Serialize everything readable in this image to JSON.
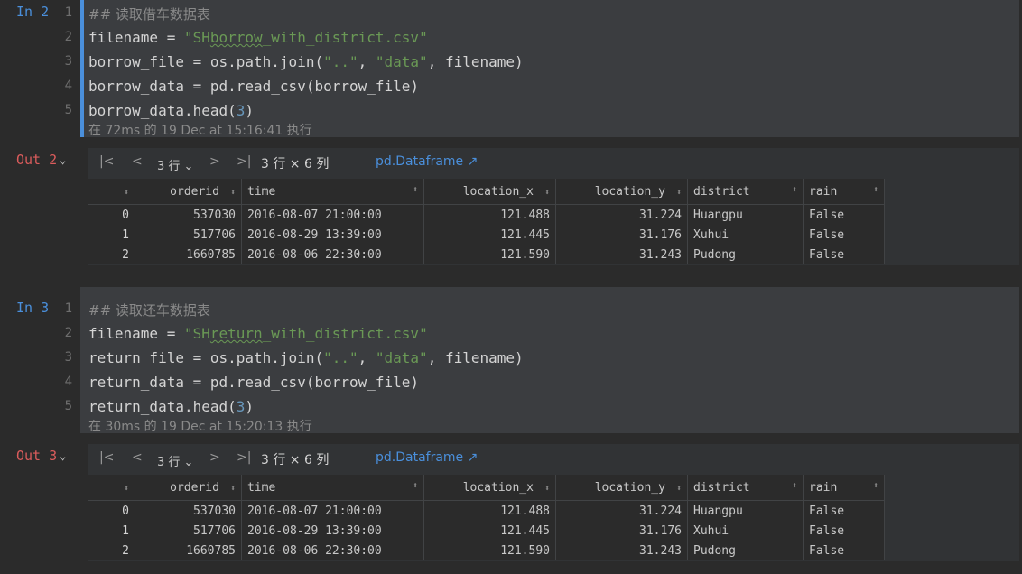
{
  "cells": [
    {
      "in_label": "In 2",
      "out_label": "Out 2",
      "lines": [
        {
          "num": "1",
          "parts": [
            {
              "t": "## 读取借车数据表",
              "c": "cmt"
            }
          ]
        },
        {
          "num": "2",
          "parts": [
            {
              "t": "filename = ",
              "c": ""
            },
            {
              "t": "\"SH",
              "c": "str"
            },
            {
              "t": "borrow",
              "c": "str squig"
            },
            {
              "t": "_with_district.csv\"",
              "c": "str"
            }
          ]
        },
        {
          "num": "3",
          "parts": [
            {
              "t": "borrow_file = os.path.join(",
              "c": ""
            },
            {
              "t": "\"..\"",
              "c": "str"
            },
            {
              "t": ", ",
              "c": ""
            },
            {
              "t": "\"data\"",
              "c": "str"
            },
            {
              "t": ", filename)",
              "c": ""
            }
          ]
        },
        {
          "num": "4",
          "parts": [
            {
              "t": "borrow_data = pd.read_csv(borrow_file)",
              "c": ""
            }
          ]
        },
        {
          "num": "5",
          "parts": [
            {
              "t": "borrow_data.head(",
              "c": ""
            },
            {
              "t": "3",
              "c": "num"
            },
            {
              "t": ")",
              "c": ""
            }
          ]
        }
      ],
      "exec_text": "在 72ms 的 19 Dec at 15:16:41 执行",
      "toolbar": {
        "first": "|<",
        "prev": "<",
        "rows": "3 行",
        "next": ">",
        "last": ">|",
        "dims": "3 行 × 6 列",
        "link": "pd.Dataframe ↗"
      },
      "columns": [
        "",
        "orderid",
        "time",
        "location_x",
        "location_y",
        "district",
        "rain"
      ],
      "rows": [
        [
          "0",
          "537030",
          "2016-08-07 21:00:00",
          "121.488",
          "31.224",
          "Huangpu",
          "False"
        ],
        [
          "1",
          "517706",
          "2016-08-29 13:39:00",
          "121.445",
          "31.176",
          "Xuhui",
          "False"
        ],
        [
          "2",
          "1660785",
          "2016-08-06 22:30:00",
          "121.590",
          "31.243",
          "Pudong",
          "False"
        ]
      ]
    },
    {
      "in_label": "In 3",
      "out_label": "Out 3",
      "lines": [
        {
          "num": "1",
          "parts": [
            {
              "t": "## 读取还车数据表",
              "c": "cmt"
            }
          ]
        },
        {
          "num": "2",
          "parts": [
            {
              "t": "filename = ",
              "c": ""
            },
            {
              "t": "\"SH",
              "c": "str"
            },
            {
              "t": "return",
              "c": "str squig"
            },
            {
              "t": "_with_district.csv\"",
              "c": "str"
            }
          ]
        },
        {
          "num": "3",
          "parts": [
            {
              "t": "return_file = os.path.join(",
              "c": ""
            },
            {
              "t": "\"..\"",
              "c": "str"
            },
            {
              "t": ", ",
              "c": ""
            },
            {
              "t": "\"data\"",
              "c": "str"
            },
            {
              "t": ", filename)",
              "c": ""
            }
          ]
        },
        {
          "num": "4",
          "parts": [
            {
              "t": "return_data = pd.read_csv(borrow_file)",
              "c": ""
            }
          ]
        },
        {
          "num": "5",
          "parts": [
            {
              "t": "return_data.head(",
              "c": ""
            },
            {
              "t": "3",
              "c": "num"
            },
            {
              "t": ")",
              "c": ""
            }
          ]
        }
      ],
      "exec_text": "在 30ms 的 19 Dec at 15:20:13 执行",
      "toolbar": {
        "first": "|<",
        "prev": "<",
        "rows": "3 行",
        "next": ">",
        "last": ">|",
        "dims": "3 行 × 6 列",
        "link": "pd.Dataframe ↗"
      },
      "columns": [
        "",
        "orderid",
        "time",
        "location_x",
        "location_y",
        "district",
        "rain"
      ],
      "rows": [
        [
          "0",
          "537030",
          "2016-08-07 21:00:00",
          "121.488",
          "31.224",
          "Huangpu",
          "False"
        ],
        [
          "1",
          "517706",
          "2016-08-29 13:39:00",
          "121.445",
          "31.176",
          "Xuhui",
          "False"
        ],
        [
          "2",
          "1660785",
          "2016-08-06 22:30:00",
          "121.590",
          "31.243",
          "Pudong",
          "False"
        ]
      ]
    }
  ],
  "colors": {
    "active_bar": "#4a8fdb",
    "code_bg": "#3b3d40",
    "editor_bg": "#2b2b2b"
  },
  "icons": {
    "sort": "sort-icon",
    "chevron": "chevron-down-icon",
    "external": "external-link-icon"
  }
}
